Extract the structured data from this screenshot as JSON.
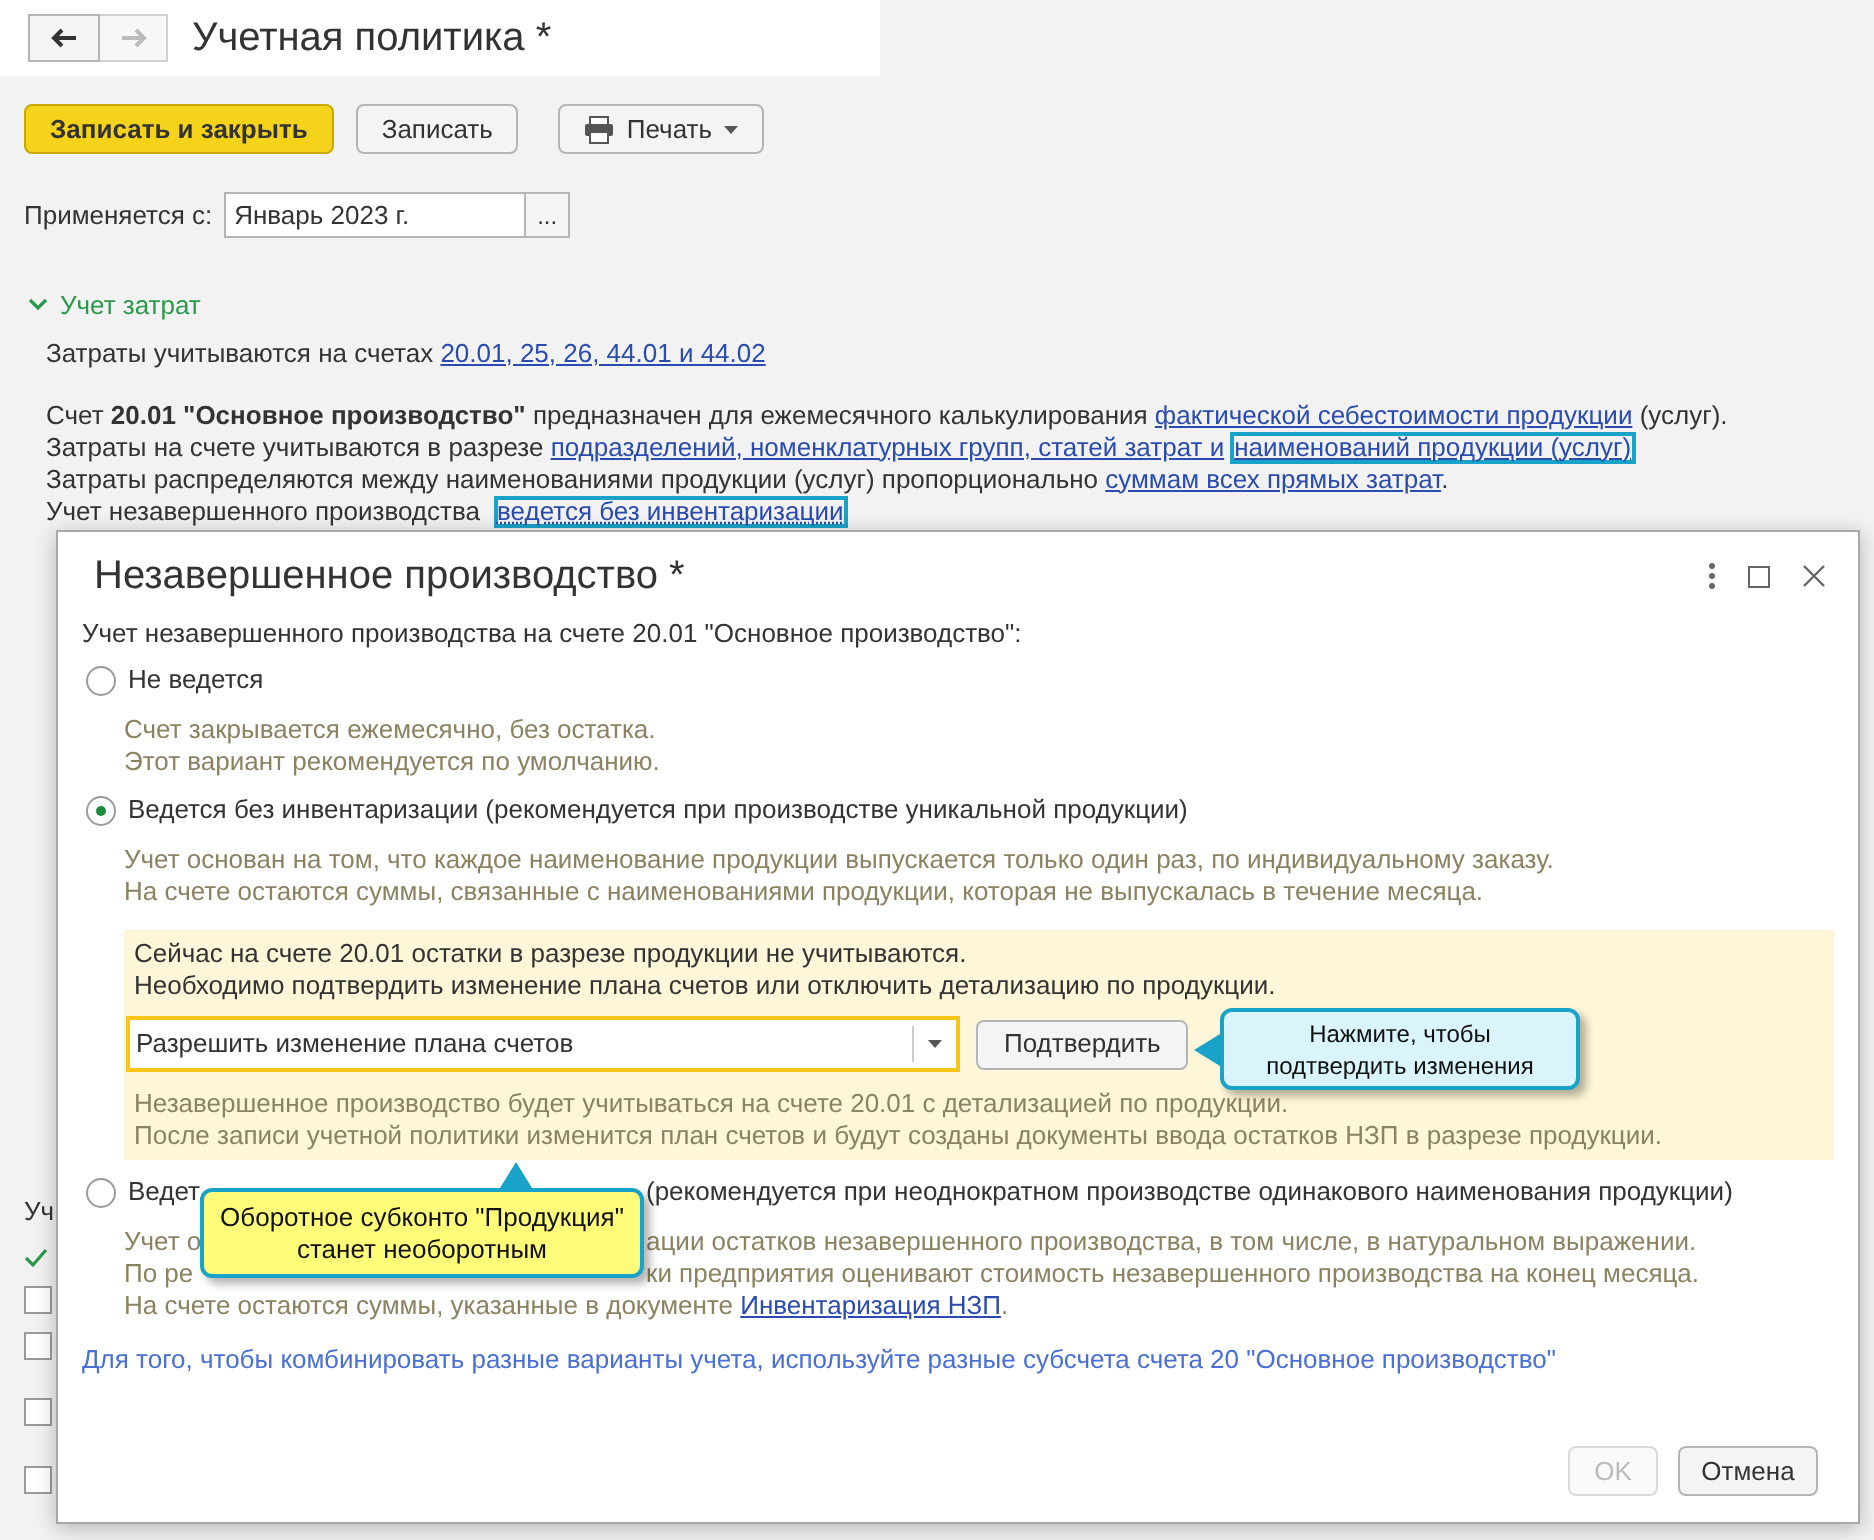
{
  "window": {
    "title": "Учетная политика *"
  },
  "toolbar": {
    "buttons": [
      {
        "label": "Записать и закрыть",
        "kind": "primary"
      },
      {
        "label": "Записать",
        "kind": "plain"
      },
      {
        "label": "Печать",
        "kind": "menu"
      }
    ]
  },
  "applies_from": {
    "label": "Применяется с:",
    "value": "Январь 2023 г.",
    "button": "..."
  },
  "section": {
    "title": "Учет затрат",
    "expanded": true,
    "lines": [
      [
        {
          "kind": "text",
          "text": "Затраты учитываются на счетах "
        },
        {
          "kind": "link",
          "text": "20.01, 25, 26, 44.01 и 44.02",
          "highlighted": false
        }
      ],
      [
        {
          "kind": "gap"
        }
      ],
      [
        {
          "kind": "text",
          "text": "Счет "
        },
        {
          "kind": "bold",
          "text": "20.01 \"Основное производство\""
        },
        {
          "kind": "text",
          "text": " предназначен для ежемесячного калькулирования "
        },
        {
          "kind": "link",
          "text": "фактической себестоимости продукции",
          "highlighted": false
        },
        {
          "kind": "text",
          "text": " (услуг)."
        }
      ],
      [
        {
          "kind": "text",
          "text": "Затраты на счете учитываются в разрезе "
        },
        {
          "kind": "link",
          "text": "подразделений, номенклатурных групп, статей затрат и",
          "highlighted": false
        },
        {
          "kind": "link",
          "text": "наименований продукции (услуг)",
          "highlighted": true
        }
      ],
      [
        {
          "kind": "text",
          "text": "Затраты распределяются между наименованиями продукции (услуг) пропорционально "
        },
        {
          "kind": "link",
          "text": "суммам всех прямых затрат",
          "highlighted": false
        },
        {
          "kind": "text",
          "text": "."
        }
      ],
      [
        {
          "kind": "text",
          "text": "Учет незавершенного производства "
        },
        {
          "kind": "dotted",
          "text": "ведется без инвентаризации",
          "highlighted": true
        }
      ]
    ]
  },
  "behind": {
    "label": "Уч",
    "checks": [
      {
        "checked": true
      },
      {
        "checked": false
      },
      {
        "checked": false
      },
      {
        "checked": false
      },
      {
        "checked": false
      }
    ]
  },
  "dialog": {
    "title": "Незавершенное производство *",
    "intro": "Учет незавершенного производства на счете 20.01 \"Основное производство\":",
    "options": [
      {
        "label": "Не ведется",
        "selected": false,
        "description": [
          "Счет закрывается ежемесячно, без остатка.",
          "Этот вариант рекомендуется по умолчанию."
        ]
      },
      {
        "label": "Ведется без инвентаризации (рекомендуется при производстве уникальной продукции)",
        "selected": true,
        "description": [
          "Учет основан на том, что каждое наименование продукции выпускается только один раз, по индивидуальному заказу.",
          "На счете остаются суммы, связанные с наименованиями продукции, которая не выпускалась в течение месяца."
        ]
      },
      {
        "label": "Ведет",
        "label_after": "(рекомендуется при неоднократном производстве одинакового наименования продукции)",
        "selected": false,
        "description_split": [
          [
            "Учет о",
            "ации остатков незавершенного производства, в том числе, в натуральном выражении."
          ],
          [
            "По ре",
            "ки предприятия оценивают стоимость незавершенного производства на конец месяца."
          ]
        ],
        "description_last": "На счете остаются суммы, указанные в документе ",
        "description_link": "Инвентаризация НЗП",
        "description_end": "."
      }
    ],
    "notice": {
      "lines": [
        "Сейчас на счете 20.01 остатки в разрезе продукции не учитываются.",
        "Необходимо подтвердить изменение плана счетов или отключить детализацию по продукции."
      ],
      "select": "Разрешить изменение плана счетов",
      "confirm": "Подтвердить",
      "result": [
        "Незавершенное производство будет учитываться на счете 20.01 с детализацией по продукции.",
        "После записи учетной политики изменится план счетов и будут созданы документы ввода остатков НЗП в разрезе продукции."
      ]
    },
    "hint": "Для того, чтобы комбинировать разные варианты учета, используйте разные субсчета счета 20 \"Основное производство\"",
    "buttons": [
      {
        "label": "OK",
        "disabled": true
      },
      {
        "label": "Отмена",
        "disabled": false
      }
    ]
  },
  "callouts": [
    {
      "kind": "blue",
      "lines": [
        "Нажмите, чтобы",
        "подтвердить изменения"
      ]
    },
    {
      "kind": "yellow",
      "lines": [
        "Оборотное субконто \"Продукция\"",
        "станет необоротным"
      ]
    }
  ]
}
